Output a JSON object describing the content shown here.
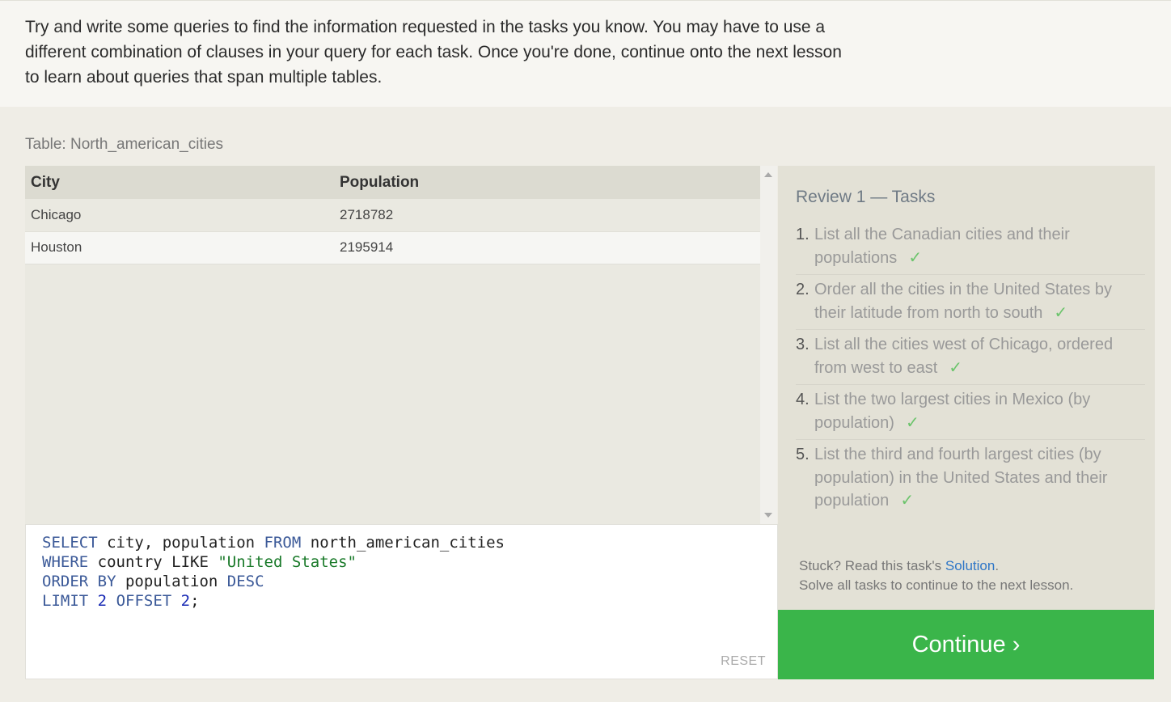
{
  "intro": {
    "text": "Try and write some queries to find the information requested in the tasks you know. You may have to use a different combination of clauses in your query for each task. Once you're done, continue onto the next lesson to learn about queries that span multiple tables."
  },
  "table_label": "Table: North_american_cities",
  "results": {
    "columns": [
      "City",
      "Population"
    ],
    "rows": [
      [
        "Chicago",
        "2718782"
      ],
      [
        "Houston",
        "2195914"
      ]
    ]
  },
  "editor": {
    "lines": [
      [
        {
          "t": "SELECT",
          "c": "kw"
        },
        {
          "t": " city, population ",
          "c": ""
        },
        {
          "t": "FROM",
          "c": "kw"
        },
        {
          "t": " north_american_cities",
          "c": ""
        }
      ],
      [
        {
          "t": "WHERE",
          "c": "kw"
        },
        {
          "t": " country LIKE ",
          "c": ""
        },
        {
          "t": "\"United States\"",
          "c": "str"
        }
      ],
      [
        {
          "t": "ORDER BY",
          "c": "kw"
        },
        {
          "t": " population ",
          "c": ""
        },
        {
          "t": "DESC",
          "c": "kw"
        }
      ],
      [
        {
          "t": "LIMIT",
          "c": "kw"
        },
        {
          "t": " ",
          "c": ""
        },
        {
          "t": "2",
          "c": "num"
        },
        {
          "t": " ",
          "c": ""
        },
        {
          "t": "OFFSET",
          "c": "kw"
        },
        {
          "t": " ",
          "c": ""
        },
        {
          "t": "2",
          "c": "num"
        },
        {
          "t": ";",
          "c": ""
        }
      ]
    ],
    "reset_label": "RESET"
  },
  "tasks": {
    "title": "Review 1 — Tasks",
    "check_mark": "✓",
    "items": [
      {
        "num": "1.",
        "text": "List all the Canadian cities and their populations"
      },
      {
        "num": "2.",
        "text": "Order all the cities in the United States by their latitude from north to south"
      },
      {
        "num": "3.",
        "text": "List all the cities west of Chicago, ordered from west to east"
      },
      {
        "num": "4.",
        "text": "List the two largest cities in Mexico (by population)"
      },
      {
        "num": "5.",
        "text": "List the third and fourth largest cities (by population) in the United States and their population"
      }
    ],
    "stuck_prefix": "Stuck? Read this task's ",
    "solution_link": "Solution",
    "stuck_suffix": ".",
    "continue_note": "Solve all tasks to continue to the next lesson."
  },
  "continue_label": "Continue ›",
  "colors": {
    "continue_bg": "#3ab54a",
    "keyword": "#3b5998",
    "string": "#1a7a2a",
    "check": "#6cc46c"
  }
}
